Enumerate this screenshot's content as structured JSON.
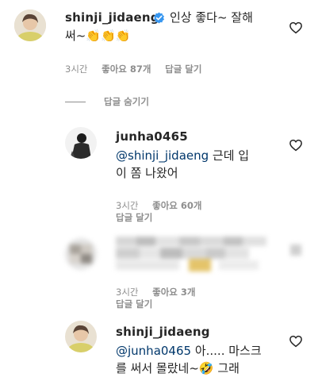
{
  "comments": [
    {
      "username": "shinji_jidaeng",
      "verified": true,
      "text": "인상 좋다~ 잘해",
      "text_line2": "써~",
      "emojis": [
        "👏",
        "👏",
        "👏"
      ],
      "time": "3시간",
      "likes": "좋아요 87개",
      "reply": "답글 달기"
    }
  ],
  "hide_replies": "답글 숨기기",
  "replies": [
    {
      "username": "junha0465",
      "mention": "@shinji_jidaeng",
      "text": " 근데 입",
      "text_line2": "이 쫌 나왔어",
      "time": "3시간",
      "likes": "좋아요 60개",
      "reply": "답글 달기"
    },
    {
      "username": "",
      "blurred": true,
      "time": "3시간",
      "likes": "좋아요 3개",
      "reply": "답글 달기"
    },
    {
      "username": "shinji_jidaeng",
      "mention": "@junha0465",
      "text": " 아..... 마스크",
      "text_line2": "를 써서 몰랐네~",
      "emoji": "🤣",
      "text_tail": " 그래"
    }
  ],
  "icons": {
    "heart": "heart-outline-icon",
    "verified": "verified-badge-icon"
  },
  "colors": {
    "text": "#262626",
    "meta": "#8e8e8e",
    "mention": "#00376b",
    "verified": "#3897f0"
  }
}
